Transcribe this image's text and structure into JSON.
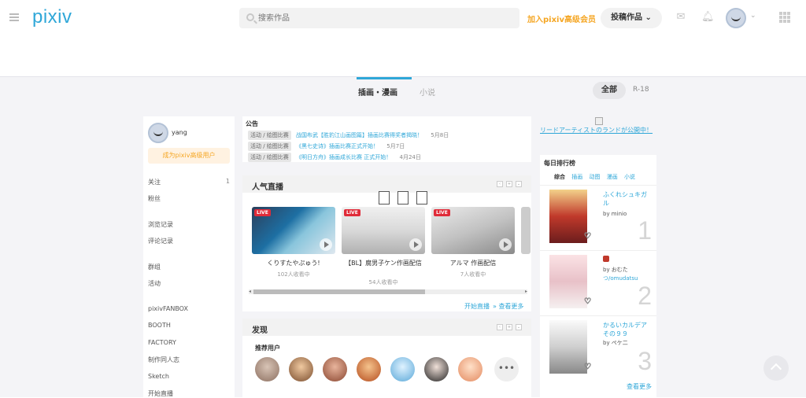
{
  "header": {
    "logo": "pixiv",
    "search_placeholder": "搜索作品",
    "premium_link": "加入pixiv高级会员",
    "post_button": "投稿作品",
    "post_caret": "⌄",
    "mail_icon": "mail-icon",
    "bell_icon": "bell-icon",
    "user_caret": "⌄"
  },
  "tabs": {
    "illust": "插画・漫画",
    "novel": "小说",
    "filter_all": "全部",
    "filter_r18": "R-18"
  },
  "sidebar": {
    "username": "yang",
    "premium_cta": "成为pixiv高级用户",
    "items": [
      {
        "label": "关注",
        "count": "1"
      },
      {
        "label": "粉丝",
        "count": ""
      },
      {
        "label": "浏览记录",
        "count": ""
      },
      {
        "label": "评论记录",
        "count": ""
      },
      {
        "label": "群组",
        "count": ""
      },
      {
        "label": "活动",
        "count": ""
      },
      {
        "label": "pixivFANBOX",
        "count": ""
      },
      {
        "label": "BOOTH",
        "count": ""
      },
      {
        "label": "FACTORY",
        "count": ""
      },
      {
        "label": "制作同人志",
        "count": ""
      },
      {
        "label": "Sketch",
        "count": ""
      },
      {
        "label": "开始直播",
        "count": ""
      }
    ]
  },
  "notice": {
    "title": "公告",
    "items": [
      {
        "tag": "活动 / 绘图比赛",
        "text": "战国布武【胜豹江山画图篇】插画比赛得奖者揭晓！",
        "date": "5月8日"
      },
      {
        "tag": "活动 / 绘图比赛",
        "text": "《黑七史诗》插画比赛正式开始！",
        "date": "5月7日"
      },
      {
        "tag": "活动 / 绘图比赛",
        "text": "《明日方舟》插画成长比赛 正式开始！",
        "date": "4月24日"
      }
    ]
  },
  "live": {
    "title": "人气直播",
    "badge": "LIVE",
    "streams": [
      {
        "name": "くりすたやぷゅう!",
        "viewers": "102人收看中"
      },
      {
        "name": "【BL】腐男子ケン作画配信",
        "viewers": "54人收看中"
      },
      {
        "name": "アルマ 作画配信",
        "viewers": "7人收看中"
      }
    ],
    "start_link": "开始直播",
    "more_link": "查看更多",
    "blank_glyphs": [
      "",
      "",
      ""
    ]
  },
  "discover": {
    "title": "发现",
    "recommended_label": "推荐用户",
    "more": "•••"
  },
  "banner": {
    "text": "リードアーティストのランドが公開中！"
  },
  "ranking": {
    "title": "每日排行榜",
    "tabs": [
      "综合",
      "插画",
      "动图",
      "漫画",
      "小说"
    ],
    "items": [
      {
        "name": "ふくれシュキガル",
        "author": "by minio",
        "rank": "1"
      },
      {
        "name": "",
        "author": "by おむた",
        "author2": "つ/omudatsu",
        "rank": "2"
      },
      {
        "name": "かるいカルデアその９９",
        "author": "by ペケ二",
        "rank": "3"
      }
    ],
    "more": "查看更多"
  }
}
